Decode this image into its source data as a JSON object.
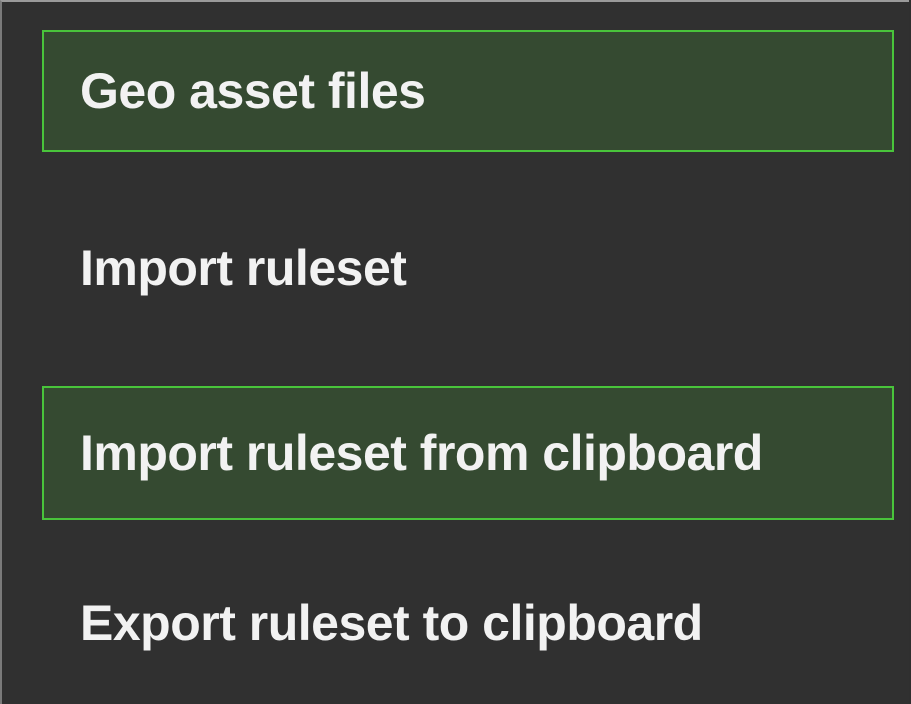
{
  "menu": {
    "items": [
      {
        "label": "Geo asset files",
        "highlighted": true
      },
      {
        "label": "Import ruleset",
        "highlighted": false
      },
      {
        "label": "Import ruleset from clipboard",
        "highlighted": true
      },
      {
        "label": "Export ruleset to clipboard",
        "highlighted": false
      }
    ]
  },
  "colors": {
    "background": "#303030",
    "highlight_fill": "#354a31",
    "highlight_border": "#49c43b",
    "text": "#f2f2f2"
  }
}
